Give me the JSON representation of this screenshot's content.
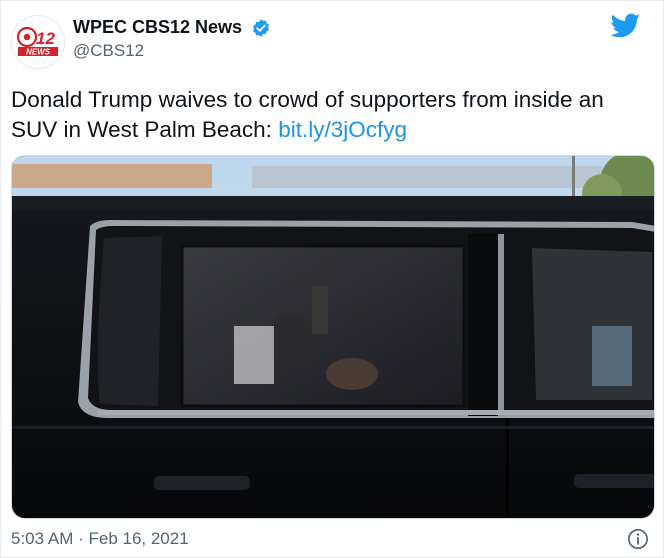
{
  "account": {
    "display_name": "WPEC CBS12 News",
    "handle": "@CBS12",
    "avatar_logo_number": "12",
    "avatar_logo_word": "NEWS"
  },
  "tweet": {
    "text_part1": "Donald Trump waives to crowd of supporters from inside an SUV in West Palm Beach: ",
    "link_text": "bit.ly/3jOcfyg",
    "media_description": "",
    "timestamp": "5:03 AM · Feb 16, 2021"
  },
  "icons": {
    "verified": "verified-badge-icon",
    "brand": "twitter-bird-icon",
    "info": "info-icon"
  },
  "colors": {
    "accent": "#1d9bf0",
    "link": "#1b95e0",
    "logo_red": "#d2232a",
    "muted": "#536471"
  }
}
